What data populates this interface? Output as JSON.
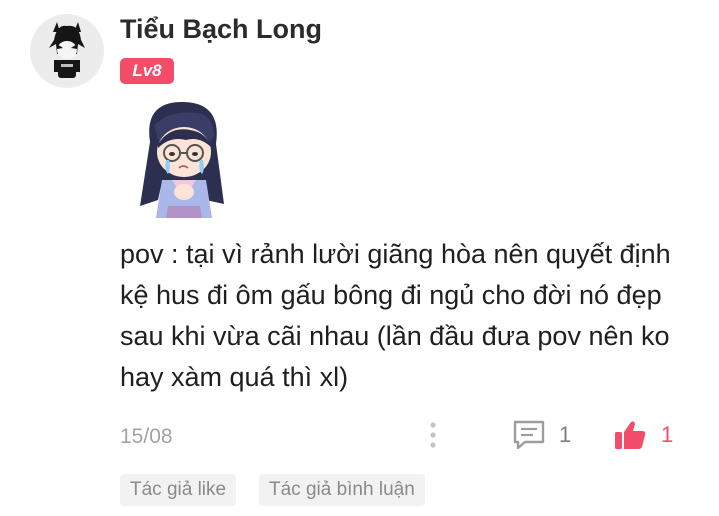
{
  "comment": {
    "author": {
      "name": "Tiểu Bạch Long",
      "level": "Lv8"
    },
    "text": "pov : tại vì rảnh lười giãng hòa nên quyết định kệ hus đi ôm gấu bông đi ngủ cho đời nó đẹp sau khi vừa cãi nhau (lần đầu đưa pov nên ko hay xàm quá thì xl)",
    "date": "15/08",
    "reply_count": "1",
    "like_count": "1",
    "tags": [
      "Tác giả like",
      "Tác giả bình luận"
    ]
  },
  "colors": {
    "accent": "#f44d6a",
    "muted_text": "#a3a3a3",
    "tag_background": "#f2f2f2"
  },
  "icons": {
    "more": "vertical-dots-icon",
    "reply": "comment-bubble-icon",
    "like": "thumbs-up-icon"
  }
}
